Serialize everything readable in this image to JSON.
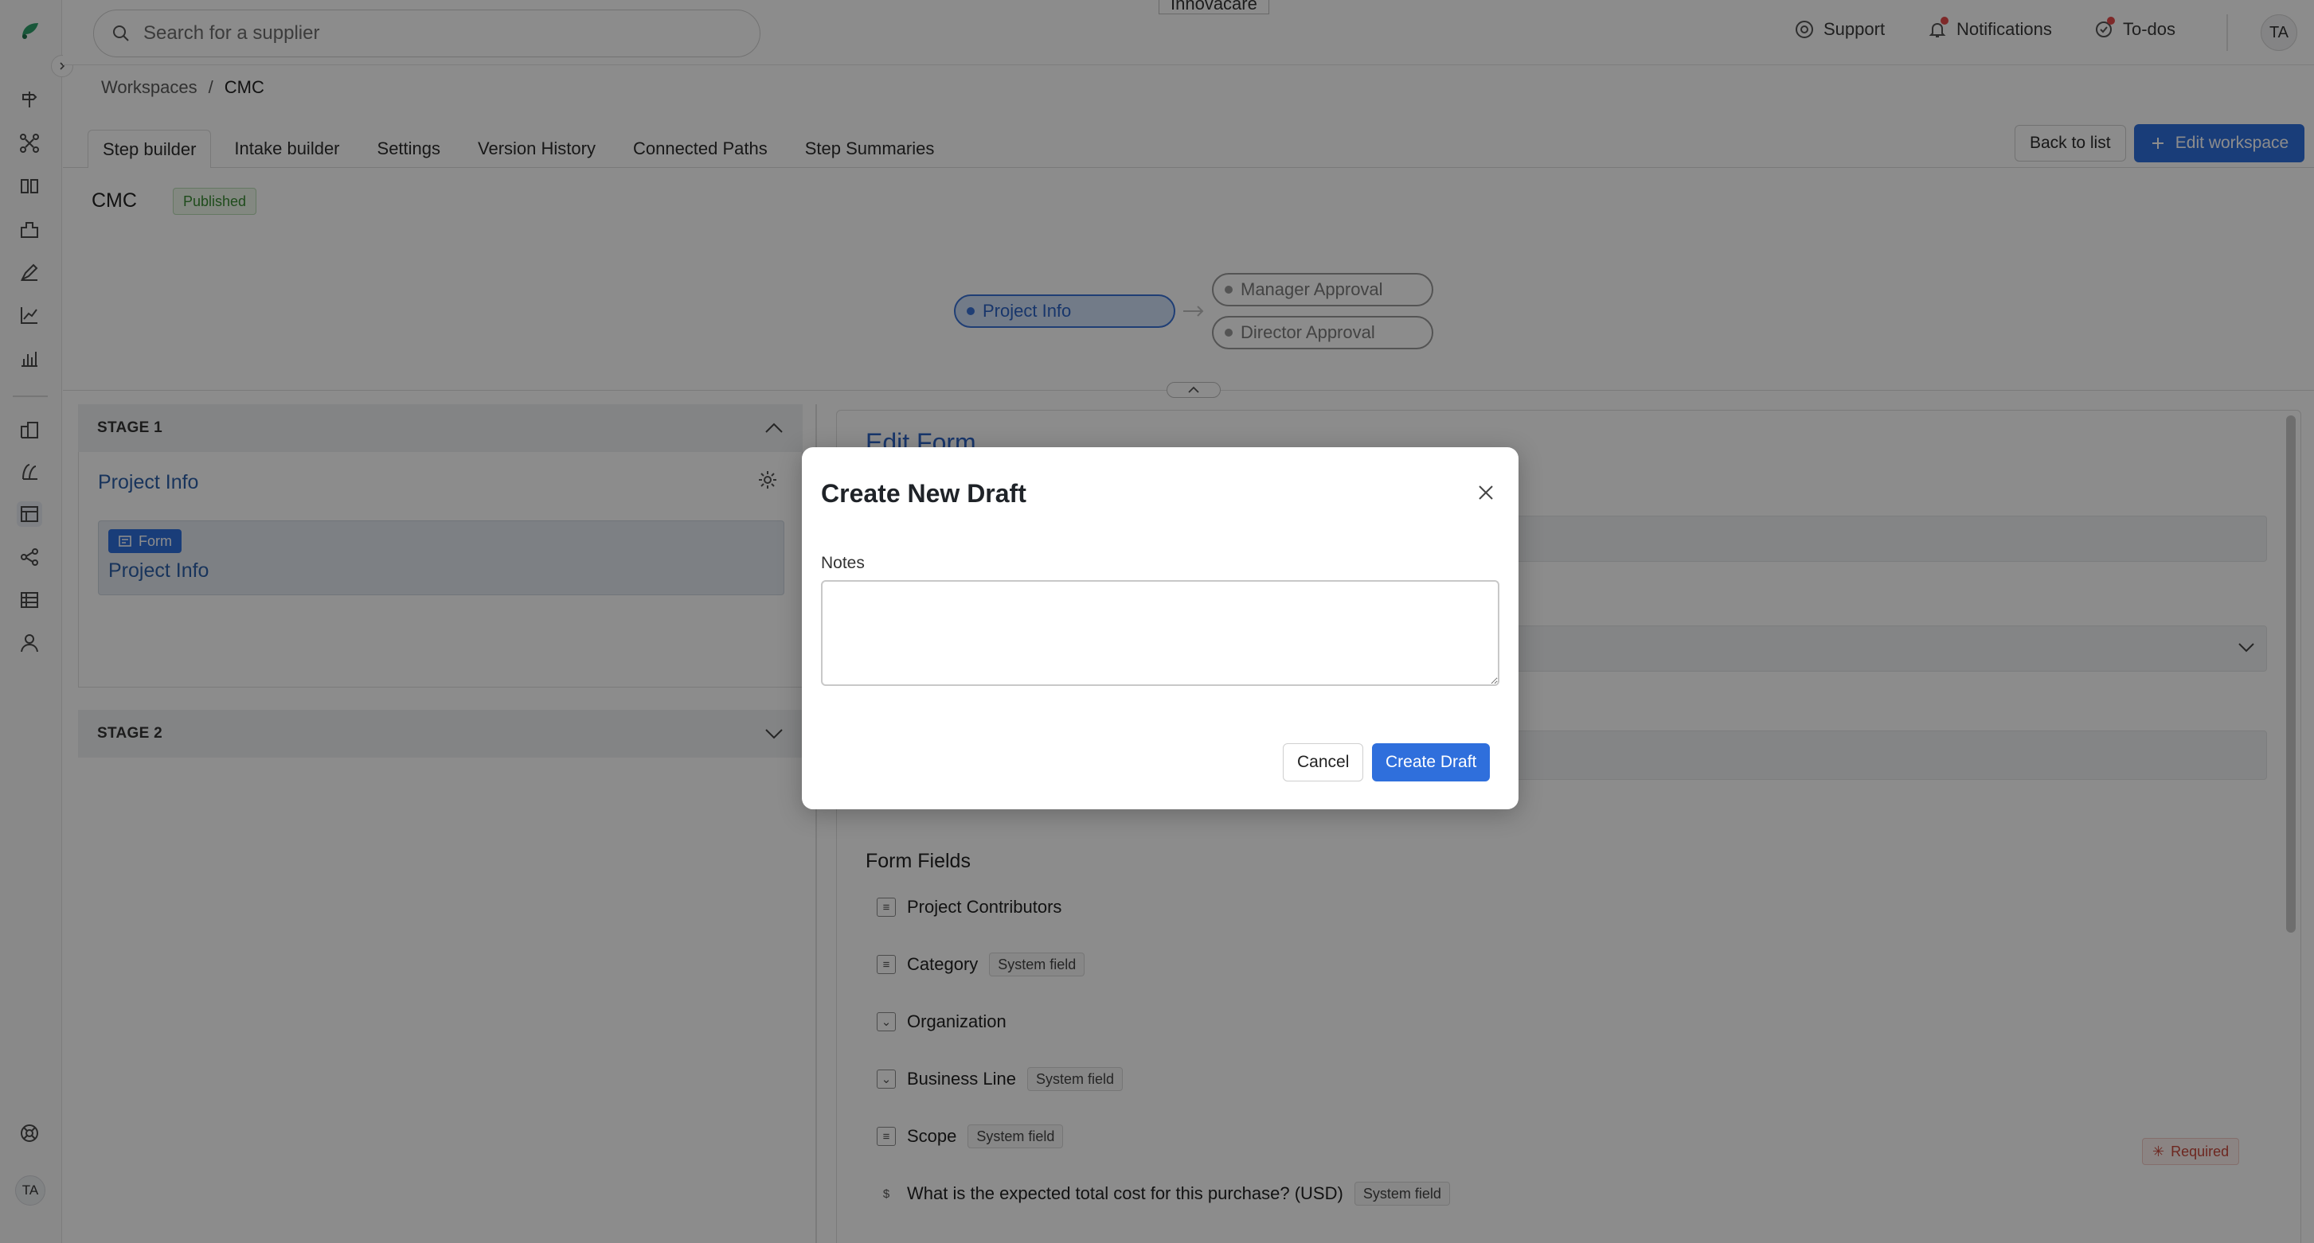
{
  "app": {
    "search_placeholder": "Search for a supplier",
    "tooltip_chip": "Innovacare",
    "user_initials": "TA"
  },
  "sidebar": {
    "icons": [
      "logo-icon",
      "intake-icon",
      "workflow-icon",
      "compare-icon",
      "suppliers-icon",
      "contracts-icon",
      "analytics-icon",
      "reports-icon",
      "buildings-icon",
      "chart-icon",
      "workspaces-icon",
      "share-icon",
      "table-icon",
      "users-icon",
      "help-icon"
    ],
    "active": "workspaces-icon"
  },
  "topnav": {
    "support": "Support",
    "notifications": "Notifications",
    "todos": "To-dos"
  },
  "breadcrumb": {
    "root": "Workspaces",
    "separator": "/",
    "current": "CMC"
  },
  "tabs": [
    "Step builder",
    "Intake builder",
    "Settings",
    "Version History",
    "Connected Paths",
    "Step Summaries"
  ],
  "actions": {
    "back": "Back to list",
    "edit": "Edit workspace"
  },
  "workspace": {
    "title": "CMC",
    "status": "Published"
  },
  "flow": {
    "steps": [
      "Project Info",
      "Manager Approval",
      "Director Approval"
    ]
  },
  "stages": [
    {
      "label": "STAGE 1",
      "step_title": "Project Info",
      "card_badge": "Form",
      "card_title": "Project Info"
    },
    {
      "label": "STAGE 2"
    }
  ],
  "edit_form": {
    "title": "Edit Form",
    "form_fields_title": "Form Fields",
    "fields": [
      {
        "label": "Project Contributors",
        "icon": "list-icon",
        "badge": ""
      },
      {
        "label": "Category",
        "icon": "list-icon",
        "badge": "System field"
      },
      {
        "label": "Organization",
        "icon": "dropdown-icon",
        "badge": ""
      },
      {
        "label": "Business Line",
        "icon": "dropdown-icon",
        "badge": "System field"
      },
      {
        "label": "Scope",
        "icon": "list-icon",
        "badge": "System field"
      },
      {
        "label": "What is the expected total cost for this purchase? (USD)",
        "icon": "currency-icon",
        "badge": "System field"
      }
    ],
    "required_label": "Required"
  },
  "modal": {
    "title": "Create New Draft",
    "notes_label": "Notes",
    "notes_value": "",
    "cancel": "Cancel",
    "submit": "Create Draft"
  },
  "colors": {
    "primary": "#2f6fdc",
    "published_text": "#3a8a33",
    "required_text": "#c7483b"
  }
}
